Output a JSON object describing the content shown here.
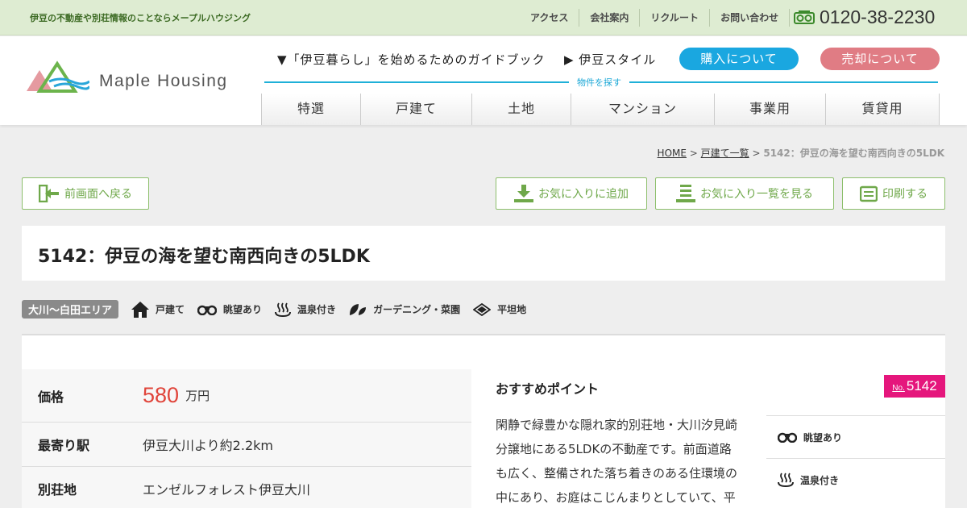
{
  "topbar": {
    "tagline": "伊豆の不動産や別荘情報のことならメープルハウジング",
    "links": [
      "アクセス",
      "会社案内",
      "リクルート",
      "お問い合わせ"
    ],
    "phone": "0120-38-2230"
  },
  "header": {
    "logo_text": "Maple Housing",
    "guide": "▼「伊豆暮らし」を始めるためのガイドブック",
    "style": "▶ 伊豆スタイル",
    "buy_label": "購入について",
    "sell_label": "売却について",
    "search_label": "物件を探す",
    "tabs": [
      "特選",
      "戸建て",
      "土地",
      "マンション",
      "事業用",
      "賃貸用"
    ]
  },
  "breadcrumb": {
    "home": "HOME",
    "sep": " > ",
    "list": "戸建て一覧",
    "current": "5142：伊豆の海を望む南西向きの5LDK"
  },
  "actions": {
    "back": "前画面へ戻る",
    "add_fav": "お気に入りに追加",
    "view_fav": "お気に入り一覧を見る",
    "print": "印刷する"
  },
  "property": {
    "title": "5142：伊豆の海を望む南西向きの5LDK",
    "area": "大川～白田エリア",
    "tags": [
      "戸建て",
      "眺望あり",
      "温泉付き",
      "ガーデニング・菜園",
      "平坦地"
    ],
    "specs": [
      {
        "label": "価格",
        "value": "580",
        "unit": "万円"
      },
      {
        "label": "最寄り駅",
        "value": "伊豆大川より約2.2km"
      },
      {
        "label": "別荘地",
        "value": "エンゼルフォレスト伊豆大川"
      }
    ],
    "rec_title": "おすすめポイント",
    "rec_text": "閑静で緑豊かな隠れ家的別荘地・大川汐見崎分譲地にある5LDKの不動産です。前面道路も広く、整備された落ち着きのある住環境の中にあり、お庭はこじんまりとしていて、平",
    "no_prefix": "No.",
    "no_value": "5142",
    "features": [
      "眺望あり",
      "温泉付き"
    ]
  },
  "colors": {
    "accent_green": "#6fa84a",
    "buy_blue": "#1aa7e0",
    "sell_pink": "#e07c84",
    "price_red": "#e0443a",
    "badge_magenta": "#e5167c"
  }
}
